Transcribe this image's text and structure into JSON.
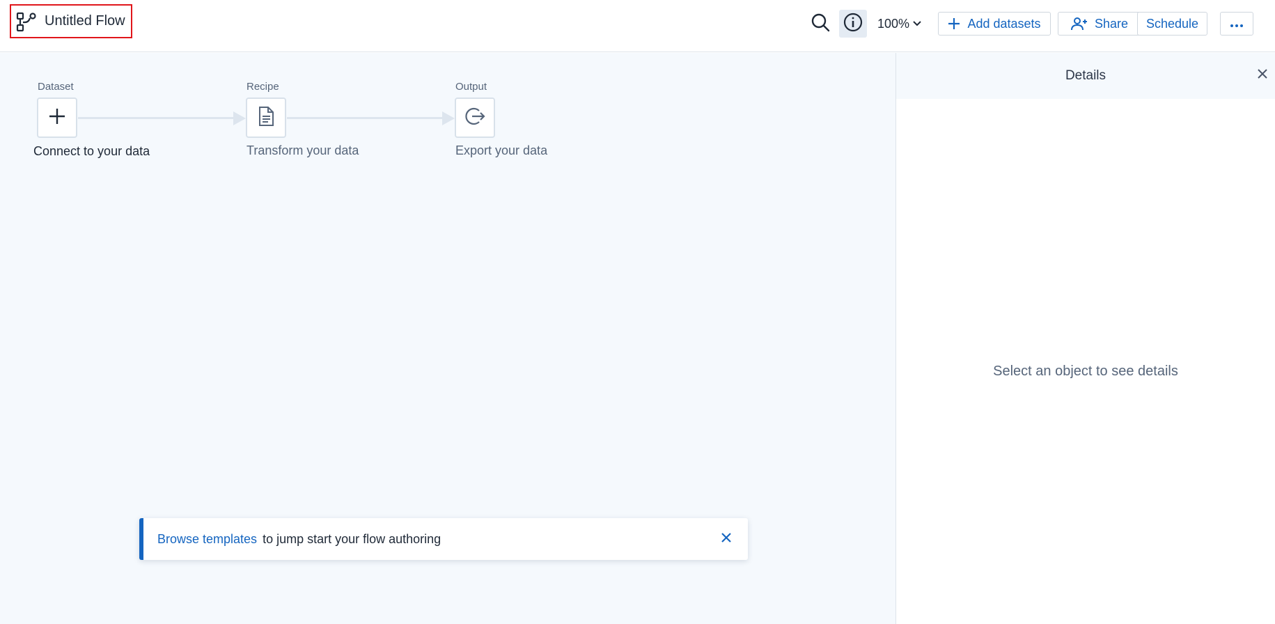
{
  "header": {
    "title": "Untitled Flow",
    "zoom_level": "100%",
    "add_datasets_label": "Add datasets",
    "share_label": "Share",
    "schedule_label": "Schedule",
    "more_label": "···"
  },
  "flow": {
    "nodes": [
      {
        "caption": "Dataset",
        "label": "Connect to your data",
        "icon": "plus-icon"
      },
      {
        "caption": "Recipe",
        "label": "Transform your data",
        "icon": "document-icon"
      },
      {
        "caption": "Output",
        "label": "Export your data",
        "icon": "export-icon"
      }
    ]
  },
  "details": {
    "title": "Details",
    "empty_message": "Select an object to see details"
  },
  "banner": {
    "link_text": "Browse templates",
    "message": "to jump start your flow authoring"
  },
  "colors": {
    "accent": "#1565c0",
    "highlight_border": "#e0161b",
    "canvas_bg": "#f5f9fd"
  }
}
